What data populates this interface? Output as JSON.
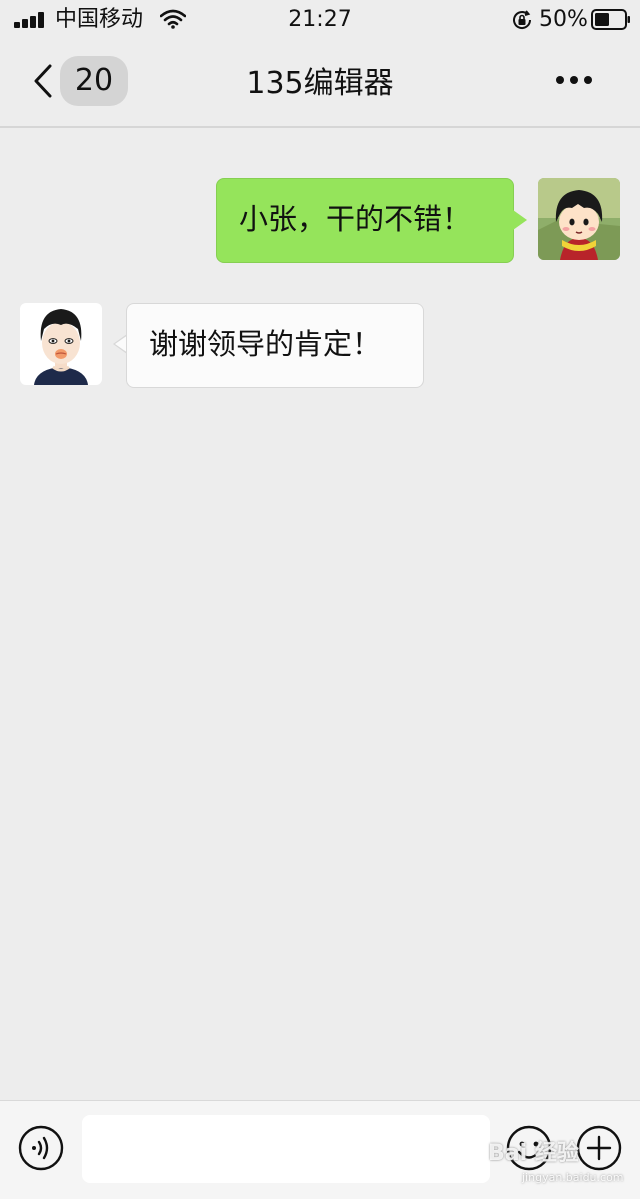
{
  "status_bar": {
    "carrier": "中国移动",
    "time": "21:27",
    "battery_percent": "50%",
    "battery_level": 0.5,
    "icons": [
      "signal-icon",
      "wifi-icon",
      "orientation-lock-icon",
      "battery-icon"
    ]
  },
  "nav": {
    "unread_count": "20",
    "title": "135编辑器",
    "icons": [
      "back-arrow-icon",
      "more-dots-icon"
    ]
  },
  "messages": [
    {
      "side": "right",
      "text": "小张，干的不错！",
      "avatar": "cartoon-girl-avatar"
    },
    {
      "side": "left",
      "text": "谢谢领导的肯定！",
      "avatar": "cartoon-boy-avatar"
    }
  ],
  "input_bar": {
    "value": "",
    "icons": [
      "voice-icon",
      "emoji-icon",
      "plus-icon"
    ]
  },
  "watermark": {
    "text": "Bai 经验",
    "sub": "jingyan.baidu.com"
  },
  "colors": {
    "background": "#ededed",
    "sent_bubble": "#95e45b",
    "received_bubble": "#fbfbfb"
  }
}
